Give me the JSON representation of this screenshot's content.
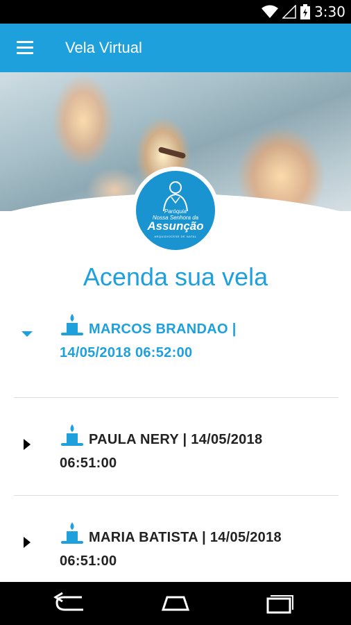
{
  "status_bar": {
    "time": "3:30",
    "icons": [
      "wifi-icon",
      "signal-icon",
      "battery-icon"
    ]
  },
  "app_bar": {
    "title": "Vela Virtual",
    "menu_icon": "hamburger-menu-icon",
    "color": "#1ea0dc"
  },
  "logo": {
    "line1": "Paróquia",
    "line2": "Nossa Senhora da",
    "line3": "Assunção",
    "line4": "ARQUIDIOCESE DE NATAL"
  },
  "heading": "Acenda sua vela",
  "list": [
    {
      "name_line": "MARCOS BRANDAO |",
      "date_line": "14/05/2018 06:52:00",
      "expanded": true,
      "icon": "candle-icon"
    },
    {
      "name_line": "PAULA NERY | 14/05/2018",
      "date_line": "06:51:00",
      "expanded": false,
      "icon": "candle-icon"
    },
    {
      "name_line": "MARIA BATISTA | 14/05/2018",
      "date_line": "06:51:00",
      "expanded": false,
      "icon": "candle-icon"
    }
  ],
  "nav_bar": {
    "buttons": [
      "back-icon",
      "home-icon",
      "recents-icon"
    ]
  },
  "colors": {
    "accent": "#1ea0dc",
    "text": "#222222"
  }
}
